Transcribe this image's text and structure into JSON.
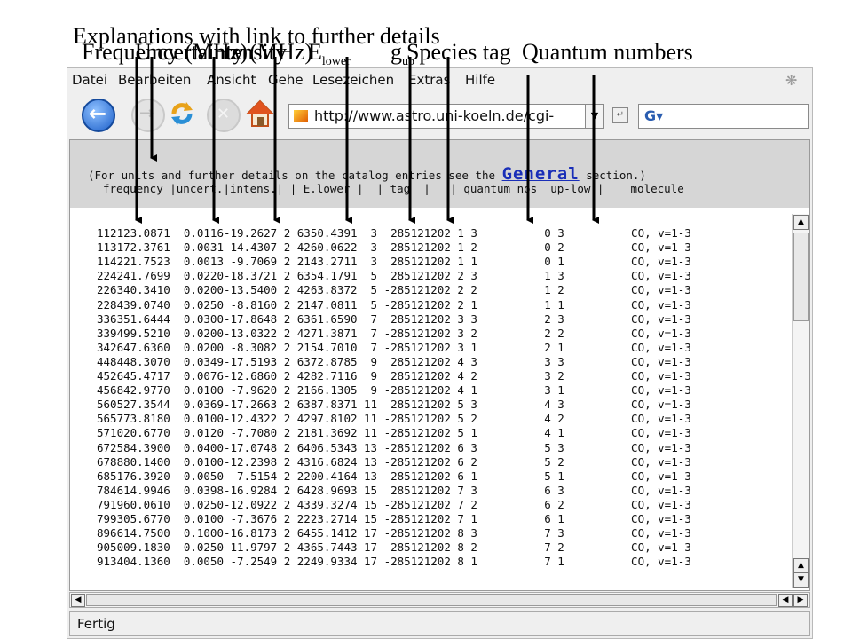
{
  "annotations": {
    "explanations": "Explanations with link to further details",
    "frequency": "Frequency (MHz)",
    "uncertainty": "Uncertainty (MHz)",
    "intensity": "Intensity",
    "elower": "E",
    "elower_sub": "lower",
    "gup": "g",
    "gup_sub": "up",
    "species_tag": "Species tag",
    "quantum_numbers": "Quantum numbers"
  },
  "menu": [
    "Datei",
    "Bearbeiten",
    "Ansicht",
    "Gehe",
    "Lesezeichen",
    "Extras",
    "Hilfe"
  ],
  "toolbar": {
    "url": "http://www.astro.uni-koeln.de/cgi-"
  },
  "page": {
    "header_line1_pre": "(For units and further details on the catalog entries see the ",
    "header_link": "General",
    "header_line1_post": " section.)",
    "header_line2": "frequency |uncert.|intens.| | E.lower |  | tag  |   | quantum nos  up-low |    molecule"
  },
  "rows": [
    "112123.0871  0.0116-19.2627 2 6350.4391  3  285121202 1 3          0 3          CO, v=1-3",
    "113172.3761  0.0031-14.4307 2 4260.0622  3  285121202 1 2          0 2          CO, v=1-3",
    "114221.7523  0.0013 -9.7069 2 2143.2711  3  285121202 1 1          0 1          CO, v=1-3",
    "224241.7699  0.0220-18.3721 2 6354.1791  5  285121202 2 3          1 3          CO, v=1-3",
    "226340.3410  0.0200-13.5400 2 4263.8372  5 -285121202 2 2          1 2          CO, v=1-3",
    "228439.0740  0.0250 -8.8160 2 2147.0811  5 -285121202 2 1          1 1          CO, v=1-3",
    "336351.6444  0.0300-17.8648 2 6361.6590  7  285121202 3 3          2 3          CO, v=1-3",
    "339499.5210  0.0200-13.0322 2 4271.3871  7 -285121202 3 2          2 2          CO, v=1-3",
    "342647.6360  0.0200 -8.3082 2 2154.7010  7 -285121202 3 1          2 1          CO, v=1-3",
    "448448.3070  0.0349-17.5193 2 6372.8785  9  285121202 4 3          3 3          CO, v=1-3",
    "452645.4717  0.0076-12.6860 2 4282.7116  9  285121202 4 2          3 2          CO, v=1-3",
    "456842.9770  0.0100 -7.9620 2 2166.1305  9 -285121202 4 1          3 1          CO, v=1-3",
    "560527.3544  0.0369-17.2663 2 6387.8371 11  285121202 5 3          4 3          CO, v=1-3",
    "565773.8180  0.0100-12.4322 2 4297.8102 11 -285121202 5 2          4 2          CO, v=1-3",
    "571020.6770  0.0120 -7.7080 2 2181.3692 11 -285121202 5 1          4 1          CO, v=1-3",
    "672584.3900  0.0400-17.0748 2 6406.5343 13 -285121202 6 3          5 3          CO, v=1-3",
    "678880.1400  0.0100-12.2398 2 4316.6824 13 -285121202 6 2          5 2          CO, v=1-3",
    "685176.3920  0.0050 -7.5154 2 2200.4164 13 -285121202 6 1          5 1          CO, v=1-3",
    "784614.9946  0.0398-16.9284 2 6428.9693 15  285121202 7 3          6 3          CO, v=1-3",
    "791960.0610  0.0250-12.0922 2 4339.3274 15 -285121202 7 2          6 2          CO, v=1-3",
    "799305.6770  0.0100 -7.3676 2 2223.2714 15 -285121202 7 1          6 1          CO, v=1-3",
    "896614.7500  0.1000-16.8173 2 6455.1412 17 -285121202 8 3          7 3          CO, v=1-3",
    "905009.1830  0.0250-11.9797 2 4365.7443 17 -285121202 8 2          7 2          CO, v=1-3",
    "913404.1360  0.0050 -7.2549 2 2249.9334 17 -285121202 8 1          7 1          CO, v=1-3"
  ],
  "status": "Fertig"
}
